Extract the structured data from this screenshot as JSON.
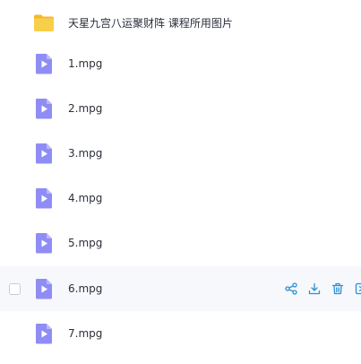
{
  "colors": {
    "folder": "#f6c343",
    "video_icon": "#8f8df5",
    "action_icon": "#2a8fd8",
    "row_hover": "#f7f8fc"
  },
  "rows": [
    {
      "name": "天星九宫八运聚财阵 课程所用图片",
      "icon": "folder-icon"
    },
    {
      "name": "1.mpg",
      "icon": "video-file-icon"
    },
    {
      "name": "2.mpg",
      "icon": "video-file-icon"
    },
    {
      "name": "3.mpg",
      "icon": "video-file-icon"
    },
    {
      "name": "4.mpg",
      "icon": "video-file-icon"
    },
    {
      "name": "5.mpg",
      "icon": "video-file-icon"
    },
    {
      "name": "6.mpg",
      "icon": "video-file-icon",
      "hovered": true
    },
    {
      "name": "7.mpg",
      "icon": "video-file-icon"
    }
  ],
  "row_actions": [
    "share-icon",
    "download-icon",
    "delete-icon",
    "more-icon"
  ]
}
